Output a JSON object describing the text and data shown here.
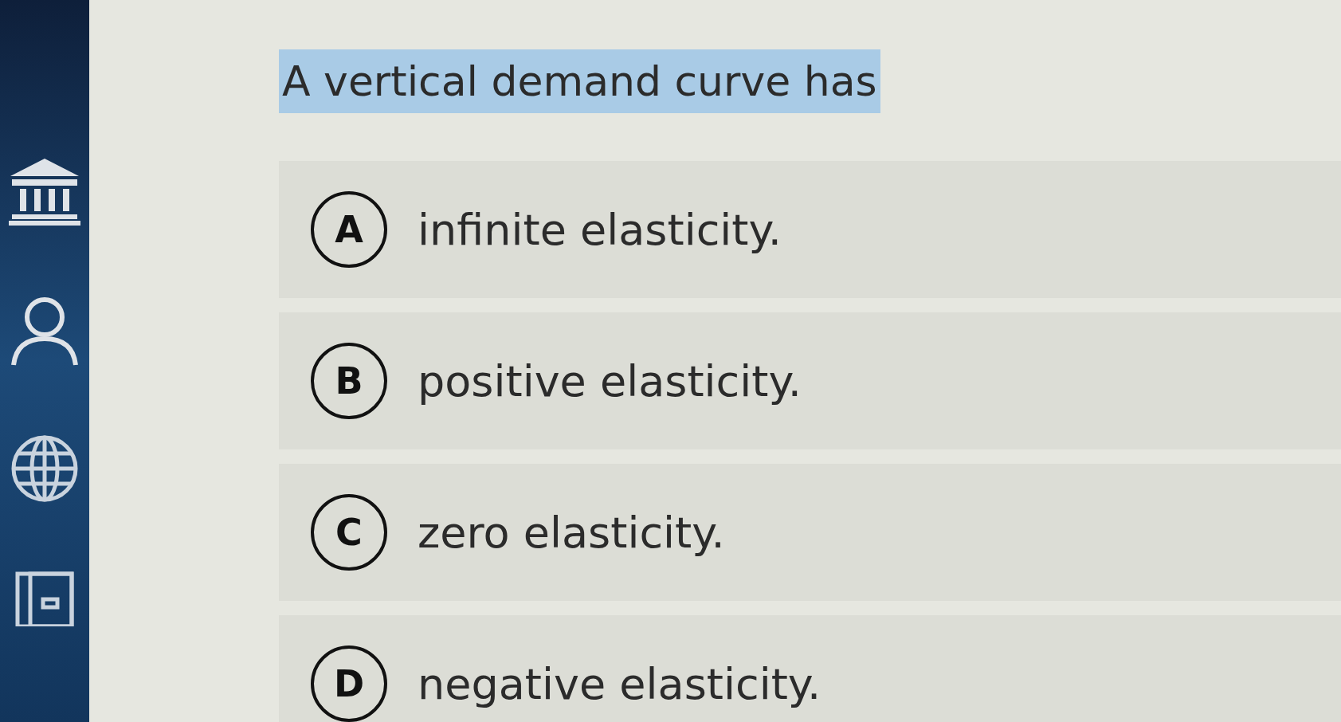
{
  "question": {
    "text": "A vertical demand curve has",
    "highlighted": true
  },
  "options": [
    {
      "letter": "A",
      "text": "infinite elasticity.",
      "selected": false
    },
    {
      "letter": "B",
      "text": "positive elasticity.",
      "selected": false
    },
    {
      "letter": "C",
      "text": "zero elasticity.",
      "selected": false
    },
    {
      "letter": "D",
      "text": "negative elasticity.",
      "selected": false
    }
  ]
}
